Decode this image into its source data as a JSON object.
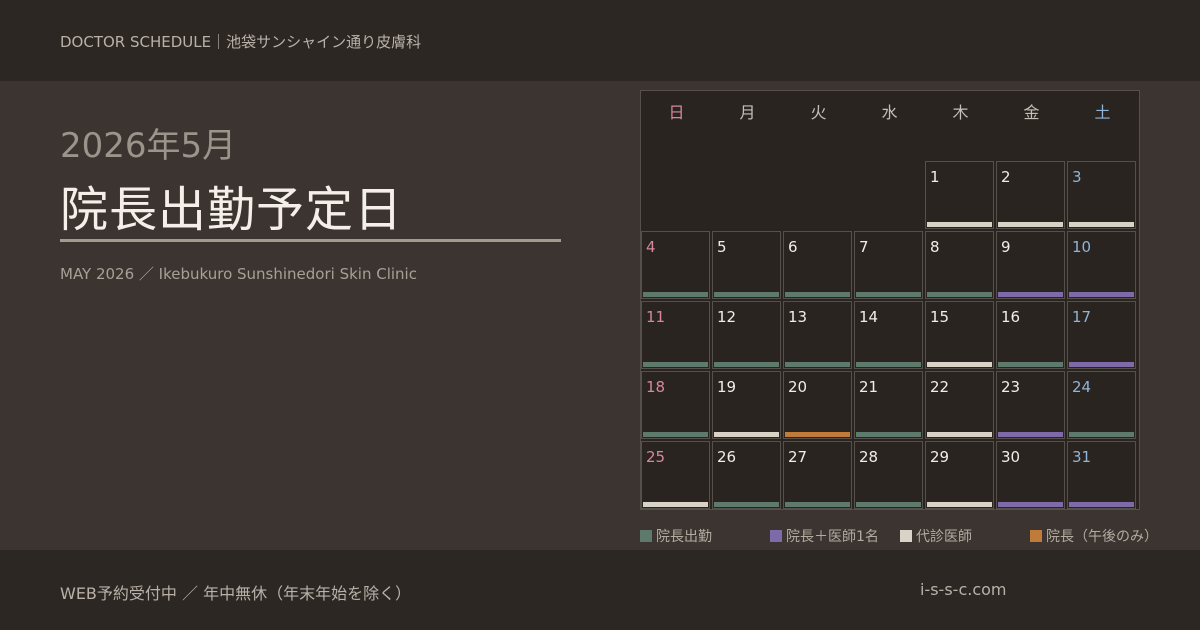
{
  "header": {
    "label": "DOCTOR SCHEDULE｜池袋サンシャイン通り皮膚科"
  },
  "hero": {
    "year_month": "2026年5月",
    "title": "院長出勤予定日",
    "subtitle": "MAY 2026 ／ Ikebukuro Sunshinedori Skin Clinic"
  },
  "colors": {
    "director": "#5d7a6c",
    "director_plus": "#7e6aa8",
    "substitute": "#d9d2c6",
    "afternoon": "#c07a3a"
  },
  "calendar": {
    "weekdays": [
      "日",
      "月",
      "火",
      "水",
      "木",
      "金",
      "土"
    ],
    "lead_blank": 4,
    "days": [
      {
        "d": "1",
        "s": "substitute"
      },
      {
        "d": "2",
        "s": "substitute"
      },
      {
        "d": "3",
        "s": "substitute"
      },
      {
        "d": "4",
        "s": "director"
      },
      {
        "d": "5",
        "s": "director"
      },
      {
        "d": "6",
        "s": "director"
      },
      {
        "d": "7",
        "s": "director"
      },
      {
        "d": "8",
        "s": "director"
      },
      {
        "d": "9",
        "s": "director_plus"
      },
      {
        "d": "10",
        "s": "director_plus"
      },
      {
        "d": "11",
        "s": "director"
      },
      {
        "d": "12",
        "s": "director"
      },
      {
        "d": "13",
        "s": "director"
      },
      {
        "d": "14",
        "s": "director"
      },
      {
        "d": "15",
        "s": "substitute"
      },
      {
        "d": "16",
        "s": "director"
      },
      {
        "d": "17",
        "s": "director_plus"
      },
      {
        "d": "18",
        "s": "director"
      },
      {
        "d": "19",
        "s": "substitute"
      },
      {
        "d": "20",
        "s": "afternoon"
      },
      {
        "d": "21",
        "s": "director"
      },
      {
        "d": "22",
        "s": "substitute"
      },
      {
        "d": "23",
        "s": "director_plus"
      },
      {
        "d": "24",
        "s": "director"
      },
      {
        "d": "25",
        "s": "substitute"
      },
      {
        "d": "26",
        "s": "director"
      },
      {
        "d": "27",
        "s": "director"
      },
      {
        "d": "28",
        "s": "director"
      },
      {
        "d": "29",
        "s": "substitute"
      },
      {
        "d": "30",
        "s": "director_plus"
      },
      {
        "d": "31",
        "s": "director_plus"
      }
    ]
  },
  "legend": [
    {
      "key": "director",
      "label": "院長出勤"
    },
    {
      "key": "director_plus",
      "label": "院長＋医師1名"
    },
    {
      "key": "substitute",
      "label": "代診医師"
    },
    {
      "key": "afternoon",
      "label": "院長（午後のみ）"
    }
  ],
  "footer": {
    "left": "WEB予約受付中 ／ 年中無休（年末年始を除く）",
    "right": "i-s-s-c.com"
  }
}
